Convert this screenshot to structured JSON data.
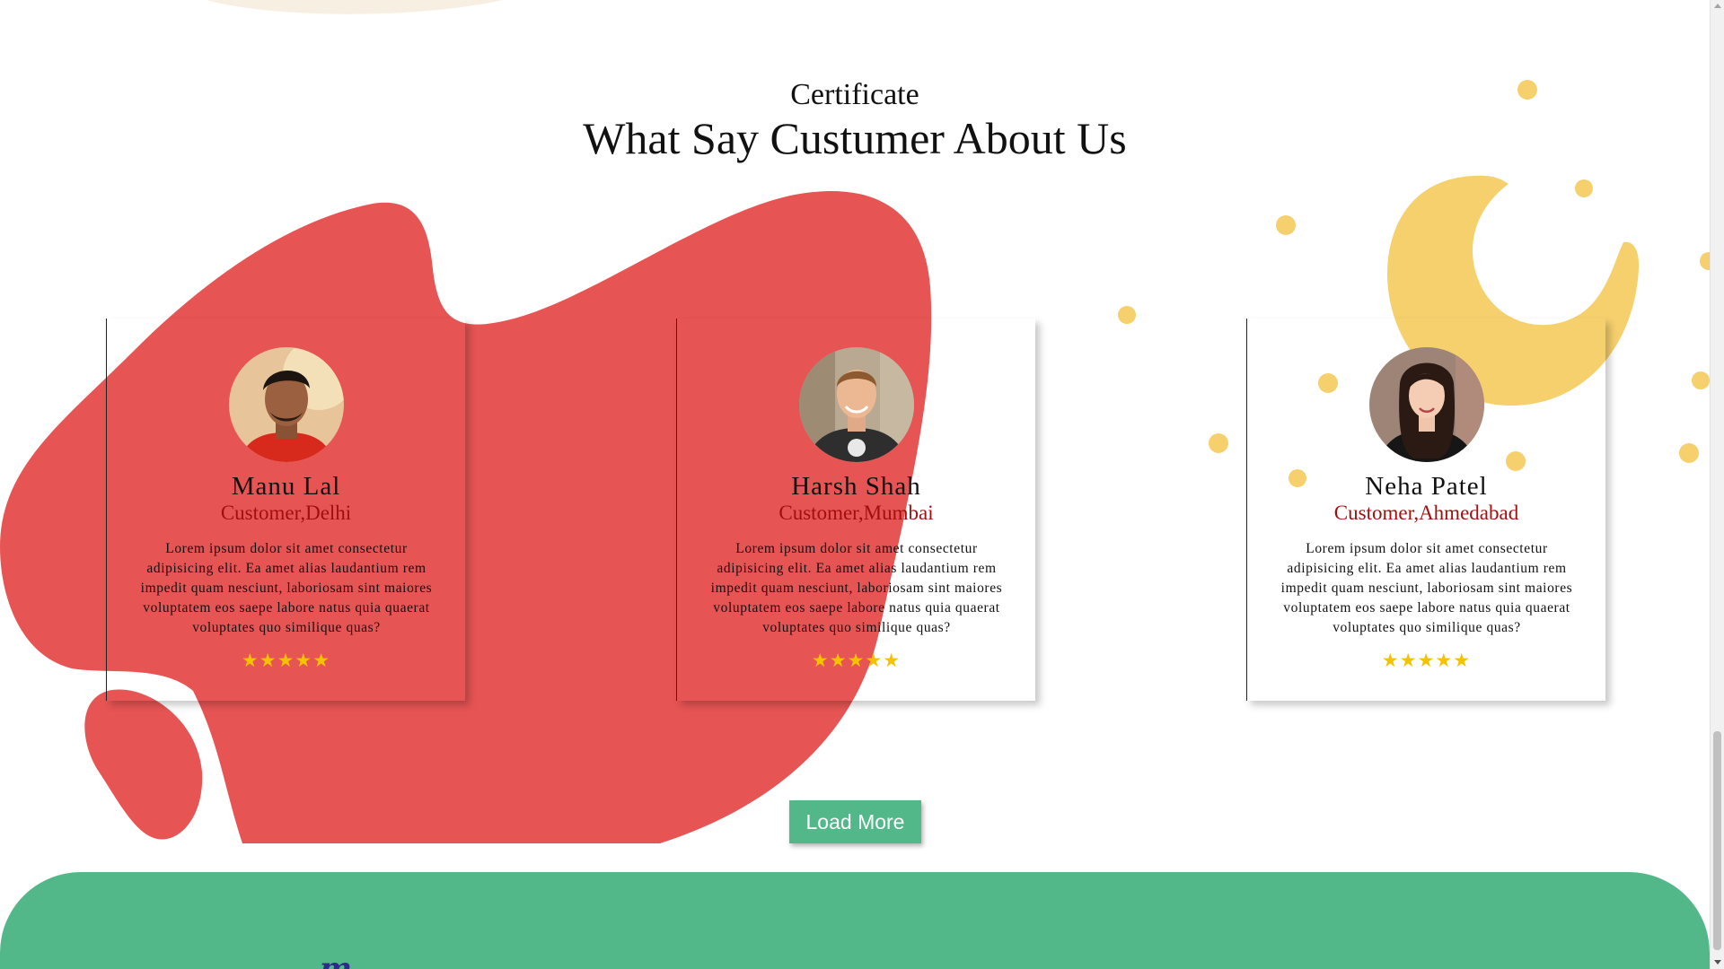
{
  "section": {
    "subtitle": "Certificate",
    "title": "What Say Custumer About Us"
  },
  "testimonials": [
    {
      "name": "Manu Lal",
      "role": "Customer,Delhi",
      "text": "Lorem ipsum dolor sit amet consectetur adipisicing elit. Ea amet alias laudantium rem impedit quam nesciunt, laboriosam sint maiores voluptatem eos saepe labore natus quia quaerat voluptates quo similique quas?",
      "rating": 5,
      "stars": "★★★★★"
    },
    {
      "name": "Harsh Shah",
      "role": "Customer,Mumbai",
      "text": "Lorem ipsum dolor sit amet consectetur adipisicing elit. Ea amet alias laudantium rem impedit quam nesciunt, laboriosam sint maiores voluptatem eos saepe labore natus quia quaerat voluptates quo similique quas?",
      "rating": 5,
      "stars": "★★★★★"
    },
    {
      "name": "Neha Patel",
      "role": "Customer,Ahmedabad",
      "text": "Lorem ipsum dolor sit amet consectetur adipisicing elit. Ea amet alias laudantium rem impedit quam nesciunt, laboriosam sint maiores voluptatem eos saepe labore natus quia quaerat voluptates quo similique quas?",
      "rating": 5,
      "stars": "★★★★★"
    }
  ],
  "load_more": {
    "label": "Load More"
  },
  "footer": {
    "logo_text": "m"
  },
  "colors": {
    "blob_red": "#e75454",
    "moon_yellow": "#f6d06d",
    "accent_green": "#53b889",
    "role_red": "#a30f0f",
    "star_gold": "#f5c200"
  },
  "icons": {
    "rating": "star-icon",
    "scroll_up": "arrow-up-icon",
    "scroll_down": "arrow-down-icon"
  }
}
